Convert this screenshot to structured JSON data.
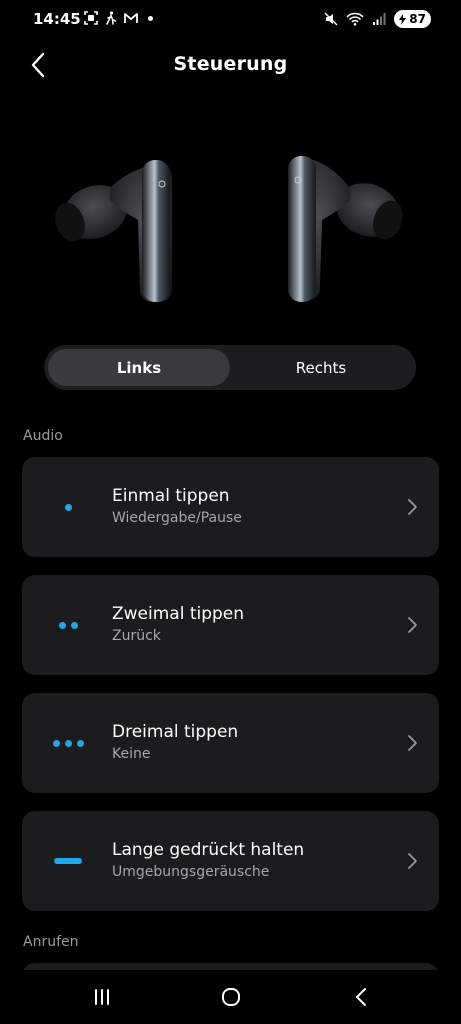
{
  "status_bar": {
    "time": "14:45",
    "battery": "87",
    "icons": [
      "screenshot-icon",
      "walking-icon",
      "gmail-icon",
      "mute-icon",
      "wifi-icon",
      "signal-icon",
      "battery-icon"
    ]
  },
  "header": {
    "title": "Steuerung",
    "back_icon": "back-arrow-icon"
  },
  "earbuds_image": "earbuds-image",
  "tabs": [
    {
      "label": "Links",
      "selected": true
    },
    {
      "label": "Rechts",
      "selected": false
    }
  ],
  "sections": {
    "audio": "Audio",
    "calls": "Anrufen"
  },
  "controls": [
    {
      "title": "Einmal tippen",
      "value": "Wiedergabe/Pause",
      "icon": "single-tap-icon"
    },
    {
      "title": "Zweimal tippen",
      "value": "Zurück",
      "icon": "double-tap-icon"
    },
    {
      "title": "Dreimal tippen",
      "value": "Keine",
      "icon": "triple-tap-icon"
    },
    {
      "title": "Lange gedrückt halten",
      "value": "Umgebungsgeräusche",
      "icon": "long-press-icon"
    }
  ],
  "colors": {
    "accent": "#1ea8ea",
    "card_bg": "#1c1c1e",
    "background": "#000000"
  }
}
